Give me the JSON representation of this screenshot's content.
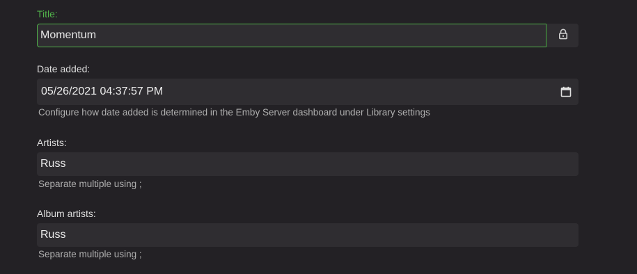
{
  "title": {
    "label": "Title:",
    "value": "Momentum",
    "lock_icon": "lock-icon"
  },
  "date_added": {
    "label": "Date added:",
    "value": "05/26/2021 04:37:57 PM",
    "help": "Configure how date added is determined in the Emby Server dashboard under Library settings",
    "calendar_icon": "calendar-icon"
  },
  "artists": {
    "label": "Artists:",
    "value": "Russ",
    "help": "Separate multiple using ;"
  },
  "album_artists": {
    "label": "Album artists:",
    "value": "Russ",
    "help": "Separate multiple using ;"
  },
  "colors": {
    "background": "#232125",
    "field_background": "#2f2d31",
    "accent": "#52b54b",
    "text": "#ececec",
    "muted_text": "#b0b0b0"
  }
}
